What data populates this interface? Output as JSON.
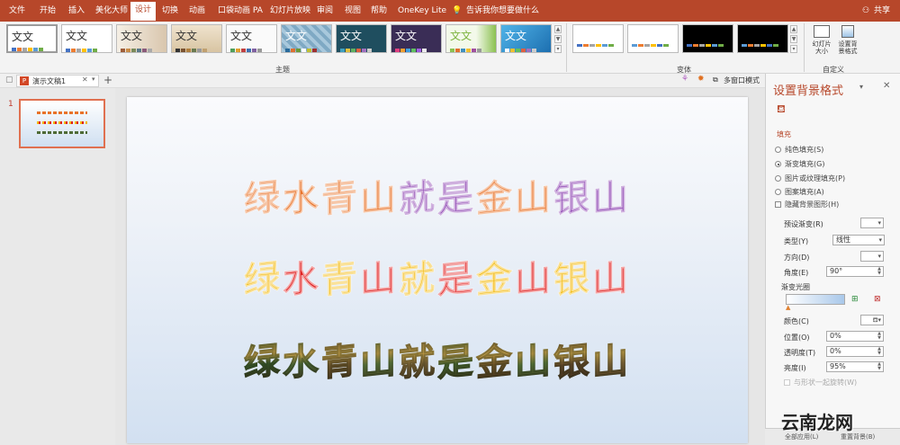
{
  "menu": {
    "tabs": [
      "文件",
      "开始",
      "插入",
      "美化大师",
      "设计",
      "切换",
      "动画",
      "口袋动画 PA",
      "幻灯片放映",
      "审阅",
      "视图",
      "帮助",
      "OneKey Lite"
    ],
    "active_tab": "设计",
    "tell_me": "告诉我你想要做什么",
    "share": "共享"
  },
  "ribbon": {
    "themes_label": "主题",
    "variants_label": "变体",
    "customize_label": "自定义",
    "theme_sample_text": "文文",
    "themes": [
      {
        "sample": "文文",
        "bg": "#ffffff",
        "fg": "#222222"
      },
      {
        "sample": "文文",
        "bg": "#ffffff",
        "fg": "#222222"
      },
      {
        "sample": "文文",
        "bg": "#e8dccb",
        "fg": "#333333"
      },
      {
        "sample": "文文",
        "bg": "#e9dcc5",
        "fg": "#333333"
      },
      {
        "sample": "文文",
        "bg": "#f8f8f8",
        "fg": "#333333"
      },
      {
        "sample": "文文",
        "bg": "#8fb6cf",
        "fg": "#ffffff"
      },
      {
        "sample": "文文",
        "bg": "#1f4e5f",
        "fg": "#ffffff"
      },
      {
        "sample": "文文",
        "bg": "#3a2d56",
        "fg": "#ffffff"
      },
      {
        "sample": "文文",
        "bg": "#e9f3dc",
        "fg": "#7db33f"
      },
      {
        "sample": "文文",
        "bg": "#2f9bd4",
        "fg": "#ffffff"
      }
    ],
    "slide_size_label": "幻灯片\n大小",
    "format_bg_label": "设置背\n景格式"
  },
  "docbar": {
    "doc_tab": "演示文稿1",
    "multiwindow": "多窗口模式"
  },
  "slides": {
    "current_number": "1"
  },
  "slide_content": {
    "rows": [
      {
        "text": "绿水青山就是金山银山",
        "colors": [
          "#e8732a",
          "#e8732a",
          "#e8732a",
          "#e8732a",
          "#8a3fb0",
          "#8a3fb0",
          "#e8732a",
          "#e8732a",
          "#8a3fb0",
          "#8a3fb0"
        ]
      },
      {
        "text": "绿水青山就是金山银山",
        "colors": [
          "#f2b705",
          "#e02020",
          "#f2b705",
          "#e02020",
          "#f2b705",
          "#e02020",
          "#f2b705",
          "#e02020",
          "#f2b705",
          "#e02020"
        ]
      },
      {
        "text": "绿水青山就是金山银山",
        "colors": [
          "#3a5a2a",
          "#4e6b37",
          "#7d5c2e",
          "#5d7a3c",
          "#8a6a3a",
          "#4a6a30",
          "#7a5a2a",
          "#5a7a3a",
          "#6a4a2a",
          "#8a6a3a"
        ]
      }
    ]
  },
  "panel": {
    "title": "设置背景格式",
    "section_fill": "填充",
    "options": [
      {
        "label": "纯色填充(S)",
        "selected": false
      },
      {
        "label": "渐变填充(G)",
        "selected": true
      },
      {
        "label": "图片或纹理填充(P)",
        "selected": false
      },
      {
        "label": "图案填充(A)",
        "selected": false
      }
    ],
    "hide_bg_graphics": "隐藏背景图形(H)",
    "preset_gradient": "预设渐变(R)",
    "type_label": "类型(Y)",
    "type_value": "线性",
    "direction_label": "方向(D)",
    "angle_label": "角度(E)",
    "angle_value": "90°",
    "gradient_stops": "渐变光圈",
    "color_label": "颜色(C)",
    "position_label": "位置(O)",
    "position_value": "0%",
    "transparency_label": "透明度(T)",
    "transparency_value": "0%",
    "brightness_label": "亮度(I)",
    "brightness_value": "95%",
    "rotate_with_shape": "与形状一起旋转(W)",
    "apply_all": "全部应用(L)",
    "reset_bg": "重置背景(B)"
  },
  "watermark": "云南龙网"
}
